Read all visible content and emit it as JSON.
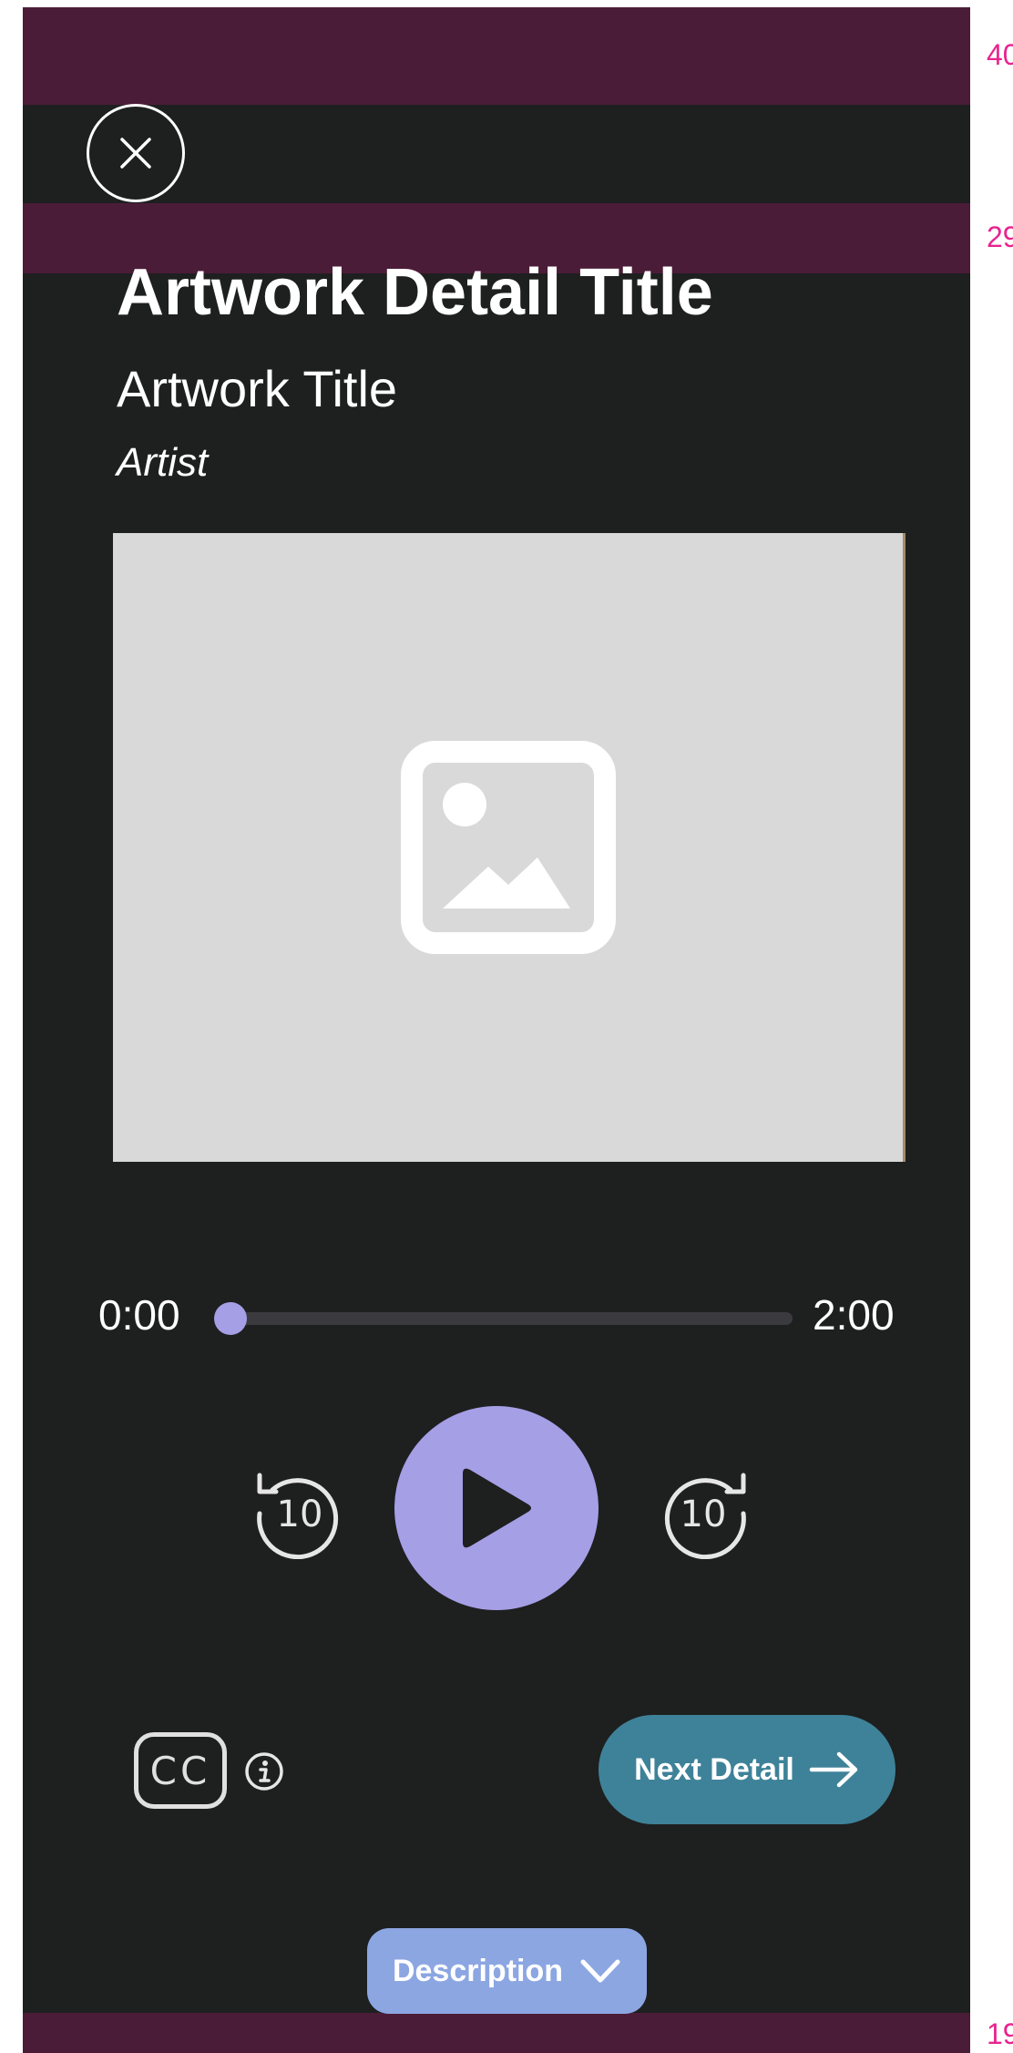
{
  "spacing_labels": {
    "top": "40",
    "middle": "29",
    "bottom": "19"
  },
  "header": {
    "detail_title": "Artwork Detail Title",
    "artwork_title": "Artwork Title",
    "artist": "Artist"
  },
  "media": {
    "placeholder_icon": "image-placeholder-icon"
  },
  "player": {
    "current_time": "0:00",
    "total_time": "2:00",
    "progress": 0,
    "skip_back_seconds": "10",
    "skip_forward_seconds": "10"
  },
  "actions": {
    "captions_label": "CC",
    "next_label": "Next Detail",
    "description_label": "Description"
  },
  "colors": {
    "background": "#1e1f1f",
    "accent": "#a59fe6",
    "next_button": "#3e8299",
    "description_button": "#8ca6e2",
    "spacing_band": "#4b1c37",
    "spacing_label": "#e8248e"
  }
}
